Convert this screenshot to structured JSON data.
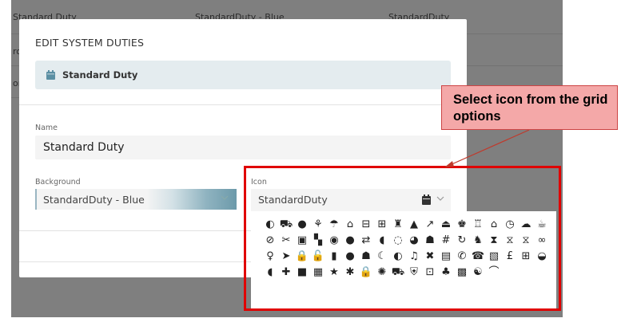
{
  "background_table": {
    "row1": [
      "Standard Duty",
      "StandardDuty - Blue",
      "StandardDuty"
    ],
    "row2_fragment": "ro",
    "row3_fragment": "on"
  },
  "modal": {
    "title": "EDIT SYSTEM DUTIES",
    "duty_chip_label": "Standard Duty",
    "name_label": "Name",
    "name_value": "Standard Duty",
    "background_label": "Background",
    "background_value": "StandardDuty - Blue",
    "icon_label": "Icon",
    "icon_value": "StandardDuty"
  },
  "icon_grid": {
    "rows": [
      [
        "◐",
        "⛟",
        "●",
        "⚘",
        "☂",
        "⌂",
        "⊟",
        "⊞",
        "♜",
        "▲",
        "↗",
        "⏏",
        "♚",
        "♖",
        "⌂",
        "◷",
        "☁"
      ],
      [
        "☕",
        "⊘",
        "✂",
        "▣",
        "▚",
        "◉",
        "●",
        "⇄",
        "◖",
        "◌",
        "◕",
        "☗",
        "#",
        "↻",
        "♞",
        "⧗",
        "⧖"
      ],
      [
        "⧖",
        "∞",
        "♀",
        "➤",
        "🔒",
        "🔓",
        "▮",
        "●",
        "☗",
        "☾",
        "◐",
        "♫",
        "✖",
        "▤",
        "✆",
        "☎",
        "▧"
      ],
      [
        "£",
        "⊞",
        "◒",
        "◖",
        "✚",
        "■",
        "▦",
        "★",
        "✱",
        "🔒",
        "✺",
        "⛟",
        "⛨",
        "⊡",
        "♣",
        "▩",
        "☯"
      ],
      [
        "⌒"
      ]
    ]
  },
  "callout": {
    "text": "Select icon from the grid options"
  },
  "colors": {
    "highlight": "#e00000",
    "callout_bg": "#f4a8a8",
    "chip_bg": "#e4ecef",
    "gradient_end": "#6c9aaa"
  }
}
